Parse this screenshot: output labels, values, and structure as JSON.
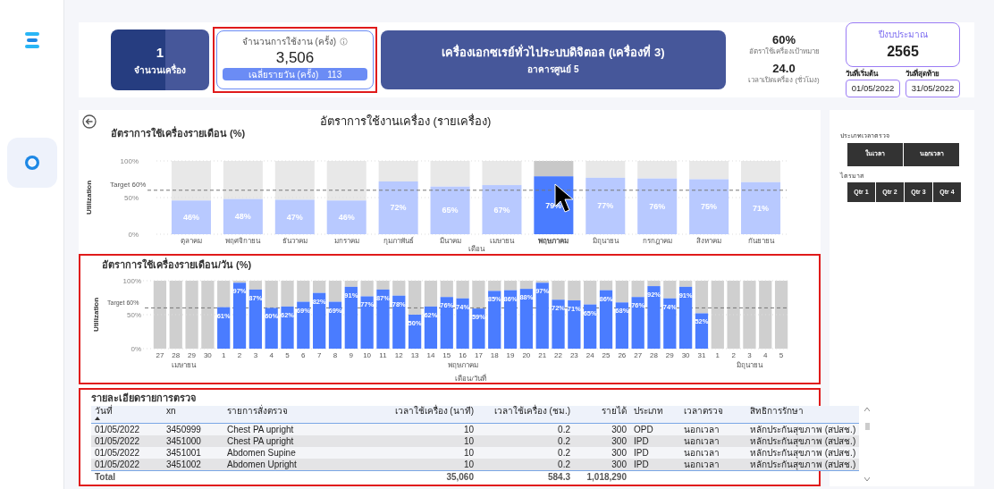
{
  "summary": {
    "machine_count": {
      "value": "1",
      "label": "จำนวนเครื่อง"
    },
    "usage_card": {
      "highlighted": true,
      "label": "จำนวนการใช้งาน (ครั้ง)",
      "value": "3,506",
      "daily_label": "เฉลี่ยรายวัน (ครั้ง)",
      "daily_value": "113"
    },
    "machine": {
      "name": "เครื่องเอกซเรย์ทั่วไประบบดิจิตอล (เครื่องที่ 3)",
      "building": "อาคารศูนย์ 5"
    },
    "stats": [
      {
        "value": "60%",
        "label": "อัตราใช้เครื่องเป้าหมาย"
      },
      {
        "value": "24.0",
        "label": "เวลาเปิดเครื่อง (ชั่วโมง)"
      }
    ],
    "budget": {
      "label": "ปีงบประมาณ",
      "value": "2565",
      "start_label": "วันที่เริ่มต้น",
      "start": "01/05/2022",
      "end_label": "วันที่สุดท้าย",
      "end": "31/05/2022"
    }
  },
  "main_title": "อัตราการใช้งานเครื่อง (รายเครื่อง)",
  "monthly_chart": {
    "highlighted": false,
    "chart_data": {
      "type": "bar",
      "title": "อัตราการใช้เครื่องรายเดือน (%)",
      "xlabel": "เดือน",
      "ylabel": "Utilization",
      "categories": [
        "ตุลาคม",
        "พฤศจิกายน",
        "ธันวาคม",
        "มกราคม",
        "กุมภาพันธ์",
        "มีนาคม",
        "เมษายน",
        "พฤษภาคม",
        "มิถุนายน",
        "กรกฎาคม",
        "สิงหาคม",
        "กันยายน"
      ],
      "values": [
        46,
        48,
        47,
        46,
        72,
        65,
        67,
        79,
        77,
        76,
        75,
        71
      ],
      "ylim": [
        0,
        100
      ],
      "yticks": [
        {
          "value": 0,
          "label": "0%"
        },
        {
          "value": 50,
          "label": "50%"
        },
        {
          "value": 100,
          "label": "100%"
        }
      ],
      "value_labels": [
        "46%",
        "48%",
        "47%",
        "46%",
        "72%",
        "65%",
        "67%",
        "79%",
        "77%",
        "76%",
        "75%",
        "71%"
      ],
      "ref_lines": [
        {
          "axis": "y",
          "value": 60,
          "label": "Target 60%"
        }
      ]
    },
    "selected": [
      false,
      false,
      false,
      false,
      false,
      false,
      false,
      true,
      false,
      false,
      false,
      false
    ]
  },
  "daily_chart": {
    "highlighted": true,
    "chart_data": {
      "type": "bar",
      "title": "อัตราการใช้เครื่องรายเดือน/วัน (%)",
      "xlabel": "เดือน/วันที่",
      "ylabel": "Utilization",
      "categories": [
        "27",
        "28",
        "29",
        "30",
        "1",
        "2",
        "3",
        "4",
        "5",
        "6",
        "7",
        "8",
        "9",
        "10",
        "11",
        "12",
        "13",
        "14",
        "15",
        "16",
        "17",
        "18",
        "19",
        "20",
        "21",
        "22",
        "23",
        "24",
        "25",
        "26",
        "27",
        "28",
        "29",
        "30",
        "31",
        "1",
        "2",
        "3",
        "4",
        "5"
      ],
      "values": [
        null,
        null,
        null,
        null,
        61,
        97,
        87,
        60,
        62,
        69,
        82,
        69,
        91,
        77,
        87,
        78,
        50,
        62,
        76,
        74,
        59,
        85,
        86,
        88,
        97,
        72,
        71,
        65,
        86,
        68,
        76,
        92,
        74,
        91,
        52,
        null,
        null,
        null,
        null,
        null
      ],
      "ylim": [
        0,
        100
      ],
      "yticks": [
        {
          "value": 0,
          "label": "0%"
        },
        {
          "value": 50,
          "label": "50%"
        },
        {
          "value": 100,
          "label": "100%"
        }
      ],
      "value_labels": [
        null,
        null,
        null,
        null,
        "61%",
        "97%",
        "87%",
        "60%",
        "62%",
        "69%",
        "82%",
        "69%",
        "91%",
        "77%",
        "87%",
        "78%",
        "50%",
        "62%",
        "76%",
        "74%",
        "59%",
        "85%",
        "86%",
        "88%",
        "97%",
        "72%",
        "71%",
        "65%",
        "86%",
        "68%",
        "76%",
        "92%",
        "74%",
        "91%",
        "52%",
        null,
        null,
        null,
        null,
        null
      ],
      "ref_lines": [
        {
          "axis": "y",
          "value": 60,
          "label": "Target 60%"
        }
      ]
    },
    "month_groups": [
      "เมษายน",
      "พฤษภาคม",
      "มิถุนายน"
    ]
  },
  "detail_table": {
    "highlighted": true,
    "title": "รายละเอียดรายการตรวจ",
    "columns": [
      "วันที่",
      "xn",
      "รายการสั่งตรวจ",
      "เวลาใช้เครื่อง (นาที)",
      "เวลาใช้เครื่อง (ชม.)",
      "รายได้",
      "ประเภท",
      "เวลาตรวจ",
      "สิทธิการรักษา"
    ],
    "rows": [
      [
        "01/05/2022",
        "3450999",
        "Chest PA upright",
        "10",
        "0.2",
        "300",
        "OPD",
        "นอกเวลา",
        "หลักประกันสุขภาพ (สปสช.)"
      ],
      [
        "01/05/2022",
        "3451000",
        "Chest PA upright",
        "10",
        "0.2",
        "300",
        "IPD",
        "นอกเวลา",
        "หลักประกันสุขภาพ (สปสช.)"
      ],
      [
        "01/05/2022",
        "3451001",
        "Abdomen Supine",
        "10",
        "0.2",
        "300",
        "IPD",
        "นอกเวลา",
        "หลักประกันสุขภาพ (สปสช.)"
      ],
      [
        "01/05/2022",
        "3451002",
        "Abdomen Upright",
        "10",
        "0.2",
        "300",
        "IPD",
        "นอกเวลา",
        "หลักประกันสุขภาพ (สปสช.)"
      ]
    ],
    "total": [
      "Total",
      "35,060",
      "584.3",
      "1,018,290"
    ]
  },
  "filters": [
    {
      "label": "ประเภทเวลาตรวจ",
      "options": [
        "ในเวลา",
        "นอกเวลา"
      ]
    },
    {
      "label": "ไตรมาส",
      "options": [
        "Qtr 1",
        "Qtr 2",
        "Qtr 3",
        "Qtr 4"
      ]
    }
  ]
}
